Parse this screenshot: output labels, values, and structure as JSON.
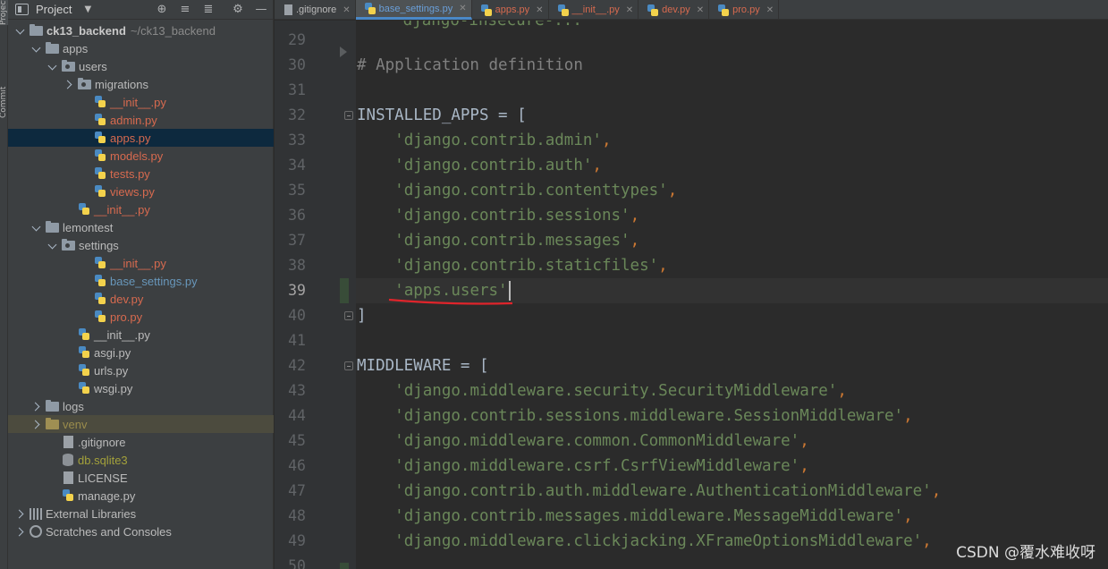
{
  "tool_strip": {
    "project_tab": "Project",
    "commit_tab": "Commit"
  },
  "project_panel": {
    "title": "Project",
    "tree": [
      {
        "label": "ck13_backend",
        "path": "~/ck13_backend",
        "arrow": "down",
        "icon": "folder",
        "indent": 0,
        "style": "bold"
      },
      {
        "label": "apps",
        "arrow": "down",
        "icon": "folder",
        "indent": 1,
        "style": ""
      },
      {
        "label": "users",
        "arrow": "down",
        "icon": "folder-pkg",
        "indent": 2,
        "style": ""
      },
      {
        "label": "migrations",
        "arrow": "right",
        "icon": "folder-pkg",
        "indent": 3,
        "style": ""
      },
      {
        "label": "__init__.py",
        "arrow": "none",
        "icon": "py",
        "indent": 4,
        "style": "red"
      },
      {
        "label": "admin.py",
        "arrow": "none",
        "icon": "py",
        "indent": 4,
        "style": "red"
      },
      {
        "label": "apps.py",
        "arrow": "none",
        "icon": "py",
        "indent": 4,
        "style": "red",
        "selected": true
      },
      {
        "label": "models.py",
        "arrow": "none",
        "icon": "py",
        "indent": 4,
        "style": "red"
      },
      {
        "label": "tests.py",
        "arrow": "none",
        "icon": "py",
        "indent": 4,
        "style": "red"
      },
      {
        "label": "views.py",
        "arrow": "none",
        "icon": "py",
        "indent": 4,
        "style": "red"
      },
      {
        "label": "__init__.py",
        "arrow": "none",
        "icon": "py",
        "indent": 3,
        "style": "red"
      },
      {
        "label": "lemontest",
        "arrow": "down",
        "icon": "folder",
        "indent": 1,
        "style": ""
      },
      {
        "label": "settings",
        "arrow": "down",
        "icon": "folder-pkg",
        "indent": 2,
        "style": ""
      },
      {
        "label": "__init__.py",
        "arrow": "none",
        "icon": "py",
        "indent": 4,
        "style": "red"
      },
      {
        "label": "base_settings.py",
        "arrow": "none",
        "icon": "py",
        "indent": 4,
        "style": "blue"
      },
      {
        "label": "dev.py",
        "arrow": "none",
        "icon": "py",
        "indent": 4,
        "style": "red"
      },
      {
        "label": "pro.py",
        "arrow": "none",
        "icon": "py",
        "indent": 4,
        "style": "red"
      },
      {
        "label": "__init__.py",
        "arrow": "none",
        "icon": "py",
        "indent": 3,
        "style": ""
      },
      {
        "label": "asgi.py",
        "arrow": "none",
        "icon": "py",
        "indent": 3,
        "style": ""
      },
      {
        "label": "urls.py",
        "arrow": "none",
        "icon": "py",
        "indent": 3,
        "style": ""
      },
      {
        "label": "wsgi.py",
        "arrow": "none",
        "icon": "py",
        "indent": 3,
        "style": ""
      },
      {
        "label": "logs",
        "arrow": "right",
        "icon": "folder",
        "indent": 1,
        "style": ""
      },
      {
        "label": "venv",
        "arrow": "right",
        "icon": "folder-venv",
        "indent": 1,
        "style": "dark-olive",
        "venv": true
      },
      {
        "label": ".gitignore",
        "arrow": "none",
        "icon": "file",
        "indent": 2,
        "style": ""
      },
      {
        "label": "db.sqlite3",
        "arrow": "none",
        "icon": "db",
        "indent": 2,
        "style": "olive"
      },
      {
        "label": "LICENSE",
        "arrow": "none",
        "icon": "file",
        "indent": 2,
        "style": ""
      },
      {
        "label": "manage.py",
        "arrow": "none",
        "icon": "py",
        "indent": 2,
        "style": ""
      },
      {
        "label": "External Libraries",
        "arrow": "right",
        "icon": "lib",
        "indent": 0,
        "style": ""
      },
      {
        "label": "Scratches and Consoles",
        "arrow": "right",
        "icon": "scratch",
        "indent": 0,
        "style": ""
      }
    ]
  },
  "tabs": [
    {
      "label": ".gitignore",
      "icon": "file",
      "color": "gray",
      "active": false
    },
    {
      "label": "base_settings.py",
      "icon": "py",
      "color": "blue",
      "active": true
    },
    {
      "label": "apps.py",
      "icon": "py",
      "color": "red",
      "active": false
    },
    {
      "label": "__init__.py",
      "icon": "py",
      "color": "red",
      "active": false
    },
    {
      "label": "dev.py",
      "icon": "py",
      "color": "red",
      "active": false
    },
    {
      "label": "pro.py",
      "icon": "py",
      "color": "red",
      "active": false
    }
  ],
  "editor": {
    "current_line": 39,
    "lines": [
      {
        "no": 29,
        "segments": []
      },
      {
        "no": 30,
        "segments": [
          {
            "t": "# Application definition",
            "c": "cm"
          }
        ]
      },
      {
        "no": 31,
        "segments": []
      },
      {
        "no": 32,
        "segments": [
          {
            "t": "INSTALLED_APPS = [",
            "c": ""
          }
        ],
        "fold": true
      },
      {
        "no": 33,
        "segments": [
          {
            "t": "    ",
            "c": ""
          },
          {
            "t": "'django.contrib.admin'",
            "c": "str"
          },
          {
            "t": ",",
            "c": "kw"
          }
        ]
      },
      {
        "no": 34,
        "segments": [
          {
            "t": "    ",
            "c": ""
          },
          {
            "t": "'django.contrib.auth'",
            "c": "str"
          },
          {
            "t": ",",
            "c": "kw"
          }
        ]
      },
      {
        "no": 35,
        "segments": [
          {
            "t": "    ",
            "c": ""
          },
          {
            "t": "'django.contrib.contenttypes'",
            "c": "str"
          },
          {
            "t": ",",
            "c": "kw"
          }
        ]
      },
      {
        "no": 36,
        "segments": [
          {
            "t": "    ",
            "c": ""
          },
          {
            "t": "'django.contrib.sessions'",
            "c": "str"
          },
          {
            "t": ",",
            "c": "kw"
          }
        ]
      },
      {
        "no": 37,
        "segments": [
          {
            "t": "    ",
            "c": ""
          },
          {
            "t": "'django.contrib.messages'",
            "c": "str"
          },
          {
            "t": ",",
            "c": "kw"
          }
        ]
      },
      {
        "no": 38,
        "segments": [
          {
            "t": "    ",
            "c": ""
          },
          {
            "t": "'django.contrib.staticfiles'",
            "c": "str"
          },
          {
            "t": ",",
            "c": "kw"
          }
        ]
      },
      {
        "no": 39,
        "segments": [
          {
            "t": "    ",
            "c": ""
          },
          {
            "t": "'apps.users'",
            "c": "str"
          }
        ]
      },
      {
        "no": 40,
        "segments": [
          {
            "t": "]",
            "c": ""
          }
        ],
        "fold": true
      },
      {
        "no": 41,
        "segments": []
      },
      {
        "no": 42,
        "segments": [
          {
            "t": "MIDDLEWARE = [",
            "c": ""
          }
        ],
        "fold": true
      },
      {
        "no": 43,
        "segments": [
          {
            "t": "    ",
            "c": ""
          },
          {
            "t": "'django.middleware.security.SecurityMiddleware'",
            "c": "str"
          },
          {
            "t": ",",
            "c": "kw"
          }
        ]
      },
      {
        "no": 44,
        "segments": [
          {
            "t": "    ",
            "c": ""
          },
          {
            "t": "'django.contrib.sessions.middleware.SessionMiddleware'",
            "c": "str"
          },
          {
            "t": ",",
            "c": "kw"
          }
        ]
      },
      {
        "no": 45,
        "segments": [
          {
            "t": "    ",
            "c": ""
          },
          {
            "t": "'django.middleware.common.CommonMiddleware'",
            "c": "str"
          },
          {
            "t": ",",
            "c": "kw"
          }
        ]
      },
      {
        "no": 46,
        "segments": [
          {
            "t": "    ",
            "c": ""
          },
          {
            "t": "'django.middleware.csrf.CsrfViewMiddleware'",
            "c": "str"
          },
          {
            "t": ",",
            "c": "kw"
          }
        ]
      },
      {
        "no": 47,
        "segments": [
          {
            "t": "    ",
            "c": ""
          },
          {
            "t": "'django.contrib.auth.middleware.AuthenticationMiddleware'",
            "c": "str"
          },
          {
            "t": ",",
            "c": "kw"
          }
        ]
      },
      {
        "no": 48,
        "segments": [
          {
            "t": "    ",
            "c": ""
          },
          {
            "t": "'django.contrib.messages.middleware.MessageMiddleware'",
            "c": "str"
          },
          {
            "t": ",",
            "c": "kw"
          }
        ]
      },
      {
        "no": 49,
        "segments": [
          {
            "t": "    ",
            "c": ""
          },
          {
            "t": "'django.middleware.clickjacking.XFrameOptionsMiddleware'",
            "c": "str"
          },
          {
            "t": ",",
            "c": "kw"
          }
        ]
      },
      {
        "no": 50,
        "segments": []
      }
    ]
  },
  "watermark": "CSDN @覆水难收呀",
  "colors": {
    "background": "#2b2b2b",
    "panel": "#3c3f41",
    "selection": "#0d293e",
    "string": "#6a8759",
    "keyword": "#cc7832",
    "comment": "#808080",
    "annotation_underline": "#e0242b",
    "tab_underline": "#4a88c7"
  }
}
